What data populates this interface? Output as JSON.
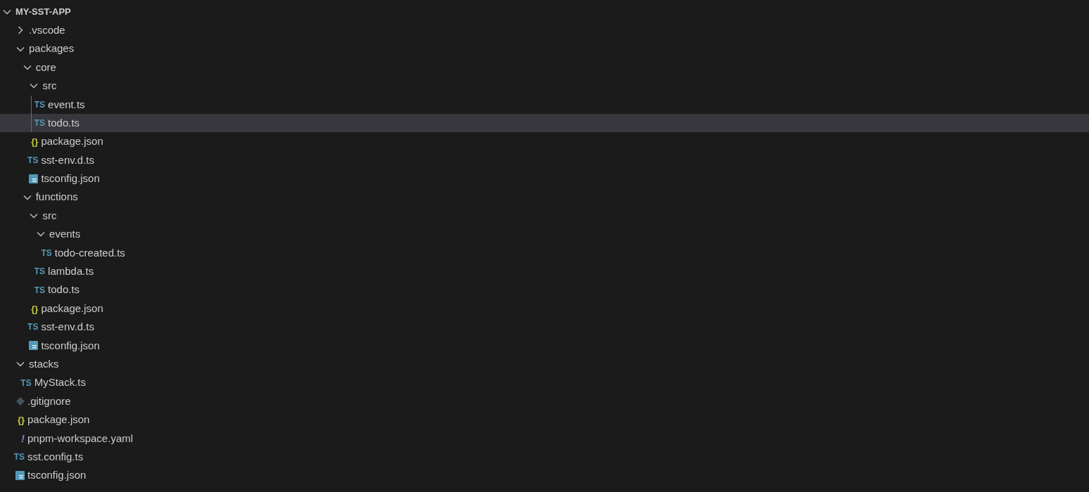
{
  "explorer": {
    "root": {
      "name": "MY-SST-APP",
      "expanded": true
    },
    "items": [
      {
        "name": ".vscode",
        "kind": "folder",
        "expanded": false
      },
      {
        "name": "packages",
        "kind": "folder",
        "expanded": true,
        "children": [
          {
            "name": "core",
            "kind": "folder",
            "expanded": true,
            "children": [
              {
                "name": "src",
                "kind": "folder",
                "expanded": true,
                "children": [
                  {
                    "name": "event.ts",
                    "kind": "ts",
                    "glyph": "TS",
                    "selected": false
                  },
                  {
                    "name": "todo.ts",
                    "kind": "ts",
                    "glyph": "TS",
                    "selected": true
                  }
                ]
              },
              {
                "name": "package.json",
                "kind": "json",
                "glyph": "{}",
                "selected": false
              },
              {
                "name": "sst-env.d.ts",
                "kind": "ts",
                "glyph": "TS",
                "selected": false
              },
              {
                "name": "tsconfig.json",
                "kind": "tsconfig",
                "selected": false
              }
            ]
          },
          {
            "name": "functions",
            "kind": "folder",
            "expanded": true,
            "children": [
              {
                "name": "src",
                "kind": "folder",
                "expanded": true,
                "children": [
                  {
                    "name": "events",
                    "kind": "folder",
                    "expanded": true,
                    "children": [
                      {
                        "name": "todo-created.ts",
                        "kind": "ts",
                        "glyph": "TS",
                        "selected": false
                      }
                    ]
                  },
                  {
                    "name": "lambda.ts",
                    "kind": "ts",
                    "glyph": "TS",
                    "selected": false
                  },
                  {
                    "name": "todo.ts",
                    "kind": "ts",
                    "glyph": "TS",
                    "selected": false
                  }
                ]
              },
              {
                "name": "package.json",
                "kind": "json",
                "glyph": "{}",
                "selected": false
              },
              {
                "name": "sst-env.d.ts",
                "kind": "ts",
                "glyph": "TS",
                "selected": false
              },
              {
                "name": "tsconfig.json",
                "kind": "tsconfig",
                "selected": false
              }
            ]
          }
        ]
      },
      {
        "name": "stacks",
        "kind": "folder",
        "expanded": true,
        "children": [
          {
            "name": "MyStack.ts",
            "kind": "ts",
            "glyph": "TS",
            "selected": false
          }
        ]
      },
      {
        "name": ".gitignore",
        "kind": "gitignore",
        "selected": false
      },
      {
        "name": "package.json",
        "kind": "json",
        "glyph": "{}",
        "selected": false
      },
      {
        "name": "pnpm-workspace.yaml",
        "kind": "yaml",
        "glyph": "!",
        "selected": false
      },
      {
        "name": "sst.config.ts",
        "kind": "ts",
        "glyph": "TS",
        "selected": false
      },
      {
        "name": "tsconfig.json",
        "kind": "tsconfig",
        "selected": false
      }
    ]
  }
}
